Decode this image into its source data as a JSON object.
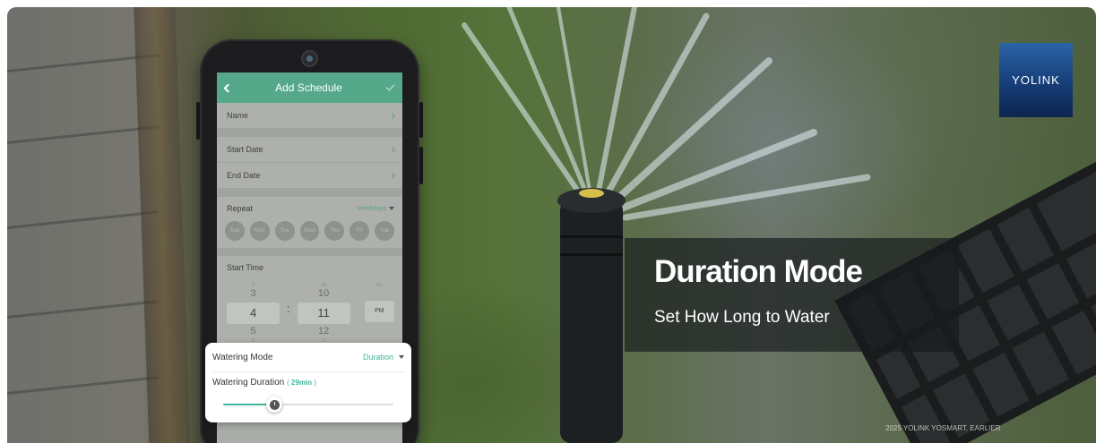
{
  "app": {
    "title": "Add Schedule",
    "rows": {
      "name": "Name",
      "start_date": "Start Date",
      "end_date": "End Date"
    },
    "repeat": {
      "label": "Repeat",
      "value": "Weekdays",
      "days": [
        "Sun",
        "Mon",
        "Tue",
        "Wed",
        "Thu",
        "Fri",
        "Sat"
      ]
    },
    "start_time": {
      "label": "Start Time",
      "hour_above2": "2",
      "hour_above": "3",
      "hour": "4",
      "hour_below": "5",
      "hour_below2": "6",
      "minute_above2": "09",
      "minute_above": "10",
      "minute": "11",
      "minute_below": "12",
      "minute_below2": "13",
      "ampm_above": "AM",
      "ampm": "PM",
      "separator": ":"
    }
  },
  "watering": {
    "mode_label": "Watering Mode",
    "mode_value": "Duration",
    "duration_label": "Watering Duration",
    "duration_open": "(",
    "duration_value": "29min",
    "duration_close": ")",
    "slider_fraction": 0.3
  },
  "banner": {
    "headline": "Duration Mode",
    "subline": "Set How Long to Water",
    "logo": "YOLINK",
    "copyright": "2025 YOLINK YOSMART. EARLIER"
  },
  "colors": {
    "accent": "#3fb59a",
    "header": "#55a88a",
    "logo_blue": "#1f4f91"
  }
}
